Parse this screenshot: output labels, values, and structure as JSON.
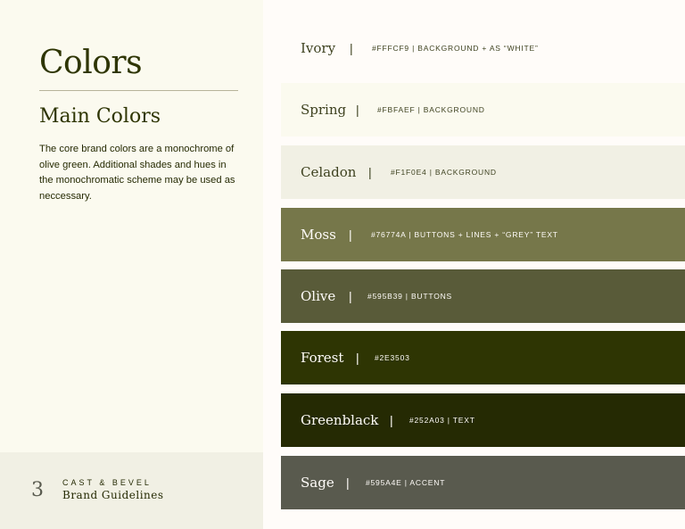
{
  "sidebar": {
    "title": "Colors",
    "section_title": "Main Colors",
    "description": "The core brand colors are a monochrome of olive green. Additional shades and hues in the monochromatic scheme may be used as neccessary.",
    "footer": {
      "page_number": "3",
      "brand_name": "CAST & BEVEL",
      "subtitle": "Brand Guidelines"
    }
  },
  "separator": "|",
  "swatches": [
    {
      "name": "Ivory",
      "hex": "#FFFCF9",
      "description": "#FFFCF9 | BACKGROUND + AS “WHITE”"
    },
    {
      "name": "Spring",
      "hex": "#FBFAEF",
      "description": "#FBFAEF | BACKGROUND"
    },
    {
      "name": "Celadon",
      "hex": "#F1F0E4",
      "description": "#F1F0E4 | BACKGROUND"
    },
    {
      "name": "Moss",
      "hex": "#76774A",
      "description": "#76774A | BUTTONS + LINES + “GREY” TEXT"
    },
    {
      "name": "Olive",
      "hex": "#595B39",
      "description": "#595B39 | BUTTONS"
    },
    {
      "name": "Forest",
      "hex": "#2E3503",
      "description": "#2E3503"
    },
    {
      "name": "Greenblack",
      "hex": "#252A03",
      "description": "#252A03 | TEXT"
    },
    {
      "name": "Sage",
      "hex": "#595A4E",
      "description": "#595A4E | ACCENT"
    }
  ]
}
